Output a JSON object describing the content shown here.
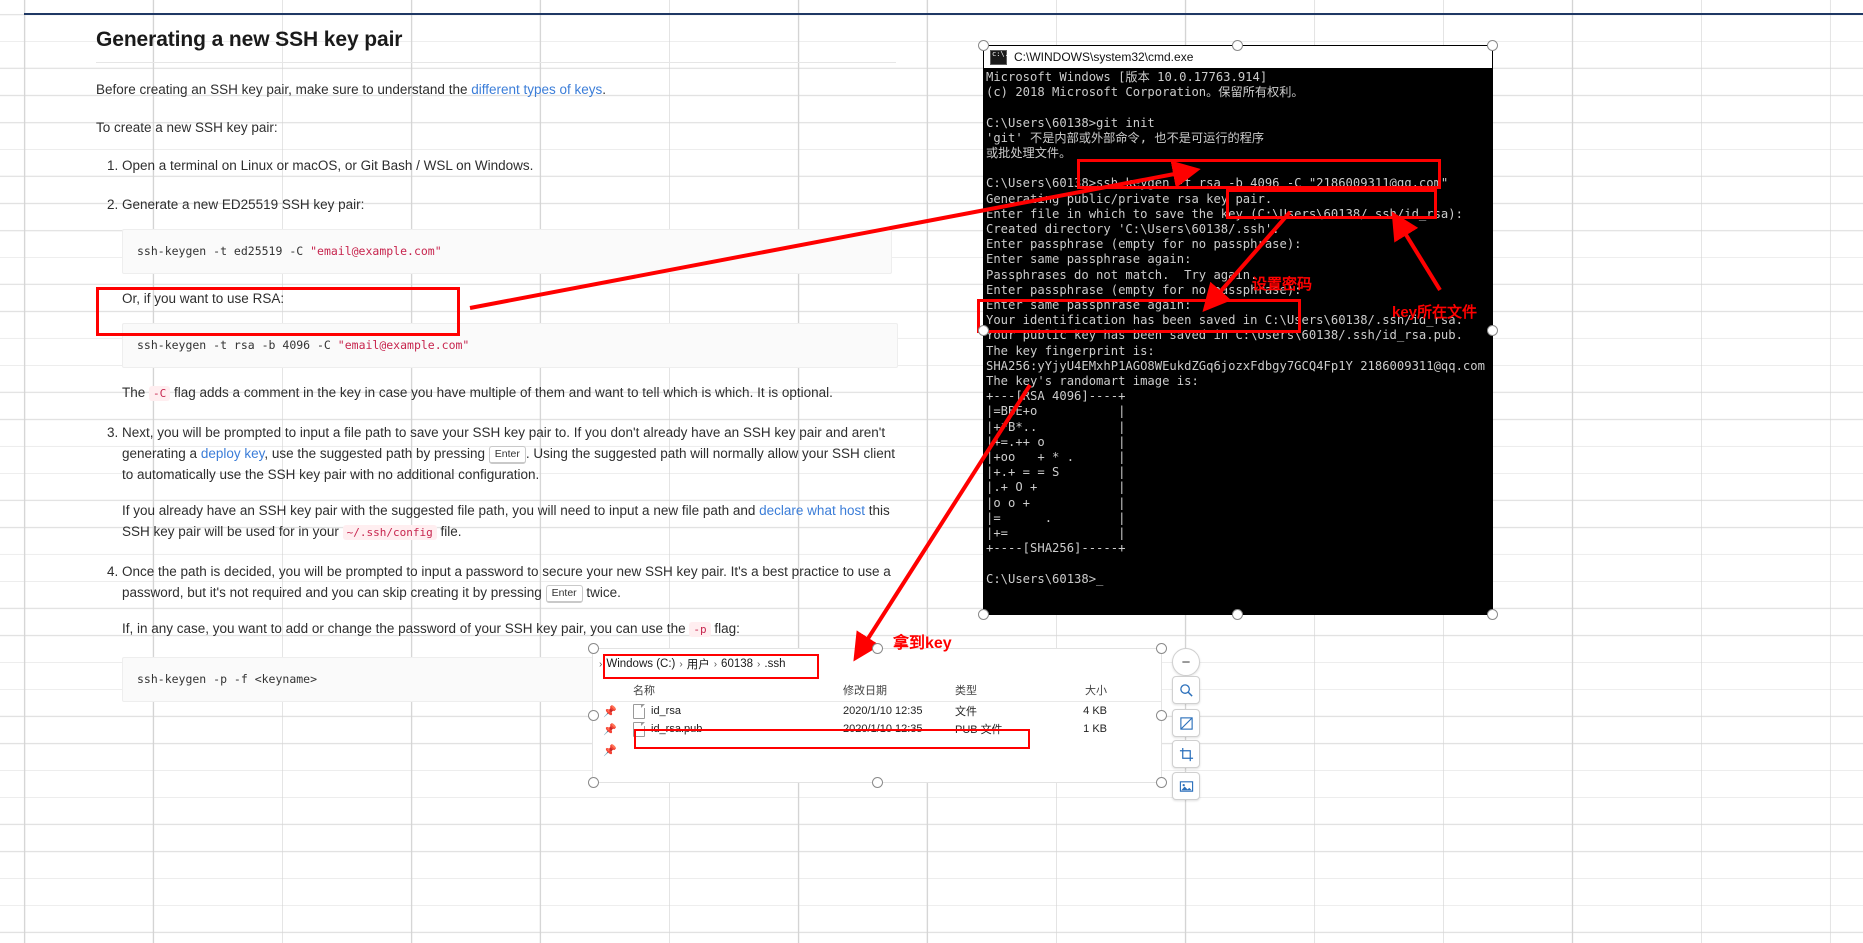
{
  "document": {
    "title": "Generating a new SSH key pair",
    "intro_prefix": "Before creating an SSH key pair, make sure to understand the ",
    "intro_link": "different types of keys",
    "intro_suffix": ".",
    "lead": "To create a new SSH key pair:",
    "step1": "Open a terminal on Linux or macOS, or Git Bash / WSL on Windows.",
    "step2": "Generate a new ED25519 SSH key pair:",
    "code_ed25519_prefix": "ssh-keygen -t ed25519 -C ",
    "code_ed25519_string": "\"email@example.com\"",
    "or_rsa": "Or, if you want to use RSA:",
    "code_rsa_prefix": "ssh-keygen -t rsa -b 4096 -C ",
    "code_rsa_string": "\"email@example.com\"",
    "c_flag_prefix": "The ",
    "c_flag_code": "-C",
    "c_flag_suffix": " flag adds a comment in the key in case you have multiple of them and want to tell which is which. It is optional.",
    "step3_a": "Next, you will be prompted to input a file path to save your SSH key pair to. If you don't already have an SSH key pair and aren't generating a ",
    "step3_link": "deploy key",
    "step3_b": ", use the suggested path by pressing ",
    "step3_kbd": "Enter",
    "step3_c": ". Using the suggested path will normally allow your SSH client to automatically use the SSH key pair with no additional configuration.",
    "step3_p2_a": "If you already have an SSH key pair with the suggested file path, you will need to input a new file path and ",
    "step3_p2_link": "declare what host",
    "step3_p2_b": " this SSH key pair will be used for in your ",
    "step3_p2_code": "~/.ssh/config",
    "step3_p2_c": " file.",
    "step4_a": "Once the path is decided, you will be prompted to input a password to secure your new SSH key pair. It's a best practice to use a password, but it's not required and you can skip creating it by pressing ",
    "step4_kbd": "Enter",
    "step4_b": " twice.",
    "step4_p2_a": "If, in any case, you want to add or change the password of your SSH key pair, you can use the ",
    "step4_p2_code": "-p",
    "step4_p2_b": " flag:",
    "code_p": "ssh-keygen -p -f <keyname>"
  },
  "cmd_window": {
    "title": "C:\\WINDOWS\\system32\\cmd.exe",
    "icon": "console-icon",
    "lines": [
      "Microsoft Windows [版本 10.0.17763.914]",
      "(c) 2018 Microsoft Corporation。保留所有权利。",
      "",
      "C:\\Users\\60138>git init",
      "'git' 不是内部或外部命令, 也不是可运行的程序",
      "或批处理文件。",
      "",
      "C:\\Users\\60138>ssh-keygen -t rsa -b 4096 -C \"2186009311@qq.com\"",
      "Generating public/private rsa key pair.",
      "Enter file in which to save the key (C:\\Users\\60138/.ssh/id_rsa):",
      "Created directory 'C:\\Users\\60138/.ssh'.",
      "Enter passphrase (empty for no passphrase):",
      "Enter same passphrase again:",
      "Passphrases do not match.  Try again.",
      "Enter passphrase (empty for no passphrase):",
      "Enter same passphrase again:",
      "Your identification has been saved in C:\\Users\\60138/.ssh/id_rsa.",
      "Your public key has been saved in C:\\Users\\60138/.ssh/id_rsa.pub.",
      "The key fingerprint is:",
      "SHA256:yYjyU4EMxhP1AGO8WEukdZGq6jozxFdbgy7GCQ4Fp1Y 2186009311@qq.com",
      "The key's randomart image is:",
      "+---[RSA 4096]----+",
      "|=BBE+o           |",
      "|+*B*..           |",
      "|+=.++ o          |",
      "|+oo   + * .      |",
      "|+.+ = = S        |",
      "|.+ O +           |",
      "|o o +            |",
      "|=      .         |",
      "|+=               |",
      "+----[SHA256]-----+",
      "",
      "C:\\Users\\60138>_"
    ]
  },
  "explorer": {
    "breadcrumb": [
      "Windows (C:)",
      "用户",
      "60138",
      ".ssh"
    ],
    "columns": [
      "名称",
      "修改日期",
      "类型",
      "大小"
    ],
    "rows": [
      {
        "name": "id_rsa",
        "date": "2020/1/10 12:35",
        "type": "文件",
        "size": "4 KB",
        "icon": "file-icon"
      },
      {
        "name": "id_rsa.pub",
        "date": "2020/1/10 12:35",
        "type": "PUB 文件",
        "size": "1 KB",
        "icon": "file-icon"
      }
    ]
  },
  "annotations": {
    "set_password": "设置密码",
    "key_location": "key所在文件",
    "get_key": "拿到key",
    "red": "#ff0000"
  },
  "toolbar": {
    "items": [
      {
        "name": "zoom-out-button",
        "glyph": "−"
      },
      {
        "name": "zoom-in-button",
        "glyph": "search"
      },
      {
        "name": "no-fill-button",
        "glyph": "no-fill"
      },
      {
        "name": "crop-button",
        "glyph": "crop"
      },
      {
        "name": "picture-settings-button",
        "glyph": "picture"
      }
    ]
  }
}
